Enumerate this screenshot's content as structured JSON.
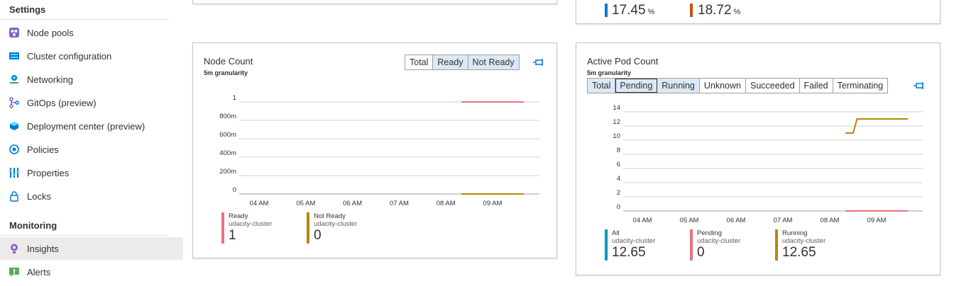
{
  "sidebar": {
    "settings_header": "Settings",
    "settings_items": [
      {
        "label": "Node pools",
        "icon": "node-pools-icon"
      },
      {
        "label": "Cluster configuration",
        "icon": "cluster-config-icon"
      },
      {
        "label": "Networking",
        "icon": "networking-icon"
      },
      {
        "label": "GitOps (preview)",
        "icon": "gitops-icon"
      },
      {
        "label": "Deployment center (preview)",
        "icon": "deployment-center-icon"
      },
      {
        "label": "Policies",
        "icon": "policies-icon"
      },
      {
        "label": "Properties",
        "icon": "properties-icon"
      },
      {
        "label": "Locks",
        "icon": "lock-icon"
      }
    ],
    "monitoring_header": "Monitoring",
    "monitoring_items": [
      {
        "label": "Insights",
        "icon": "insights-icon",
        "active": true
      },
      {
        "label": "Alerts",
        "icon": "alerts-icon"
      }
    ]
  },
  "top_right_card": {
    "metrics": [
      {
        "value": "17.45",
        "unit": "%",
        "color": "#0078d4"
      },
      {
        "value": "18.72",
        "unit": "%",
        "color": "#ca5010"
      }
    ]
  },
  "node_count": {
    "title": "Node Count",
    "granularity": "5m granularity",
    "tabs": [
      "Total",
      "Ready",
      "Not Ready"
    ],
    "selected_tabs": [
      "Ready",
      "Not Ready"
    ],
    "legend": [
      {
        "name": "Ready",
        "sub": "udacity-cluster",
        "value": "1",
        "color": "#e8727f"
      },
      {
        "name": "Not Ready",
        "sub": "udacity-cluster",
        "value": "0",
        "color": "#b8860b"
      }
    ]
  },
  "active_pod_count": {
    "title": "Active Pod Count",
    "granularity": "5m granularity",
    "tabs": [
      "Total",
      "Pending",
      "Running",
      "Unknown",
      "Succeeded",
      "Failed",
      "Terminating"
    ],
    "selected_tabs": [
      "Total",
      "Pending",
      "Running"
    ],
    "legend": [
      {
        "name": "All",
        "sub": "udacity-cluster",
        "value": "12.65",
        "color": "#0099bc"
      },
      {
        "name": "Pending",
        "sub": "udacity-cluster",
        "value": "0",
        "color": "#e8727f"
      },
      {
        "name": "Running",
        "sub": "udacity-cluster",
        "value": "12.65",
        "color": "#b8860b"
      }
    ]
  },
  "chart_data": [
    {
      "type": "line",
      "title": "Node Count",
      "x_ticks": [
        "04 AM",
        "05 AM",
        "06 AM",
        "07 AM",
        "08 AM",
        "09 AM"
      ],
      "y_ticks": [
        "0",
        "200m",
        "400m",
        "600m",
        "800m",
        "1"
      ],
      "ylim": [
        0,
        1
      ],
      "grid": true,
      "legend_position": "bottom-left",
      "series": [
        {
          "name": "Ready",
          "color": "#e8727f",
          "points": [
            [
              "08:20",
              1
            ],
            [
              "09:40",
              1
            ]
          ]
        },
        {
          "name": "Not Ready",
          "color": "#b8860b",
          "points": [
            [
              "08:20",
              0
            ],
            [
              "09:40",
              0
            ]
          ]
        }
      ]
    },
    {
      "type": "line",
      "title": "Active Pod Count",
      "x_ticks": [
        "04 AM",
        "05 AM",
        "06 AM",
        "07 AM",
        "08 AM",
        "09 AM"
      ],
      "y_ticks": [
        "0",
        "2",
        "4",
        "6",
        "8",
        "10",
        "12",
        "14"
      ],
      "ylim": [
        0,
        14
      ],
      "grid": true,
      "legend_position": "bottom-left",
      "series": [
        {
          "name": "Running",
          "color": "#b8860b",
          "points": [
            [
              "08:20",
              11
            ],
            [
              "08:30",
              11
            ],
            [
              "08:35",
              13
            ],
            [
              "09:40",
              13
            ]
          ]
        },
        {
          "name": "Pending",
          "color": "#e8727f",
          "points": [
            [
              "08:20",
              0
            ],
            [
              "09:40",
              0
            ]
          ]
        }
      ]
    }
  ]
}
